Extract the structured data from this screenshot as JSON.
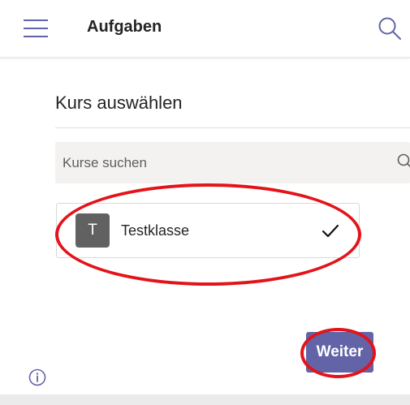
{
  "header": {
    "title": "Aufgaben",
    "menu_icon": "hamburger-menu-icon",
    "search_icon": "search-icon"
  },
  "dialog": {
    "title": "Kurs auswählen",
    "search": {
      "placeholder": "Kurse suchen",
      "value": "",
      "icon": "search-icon"
    },
    "courses": [
      {
        "initial": "T",
        "name": "Testklasse",
        "selected": true,
        "avatar_color": "#616161"
      }
    ],
    "next_button": "Weiter"
  },
  "footer": {
    "info_icon": "info-icon"
  },
  "colors": {
    "accent": "#6264a7",
    "annotation": "#e3131a",
    "avatar": "#616161"
  }
}
